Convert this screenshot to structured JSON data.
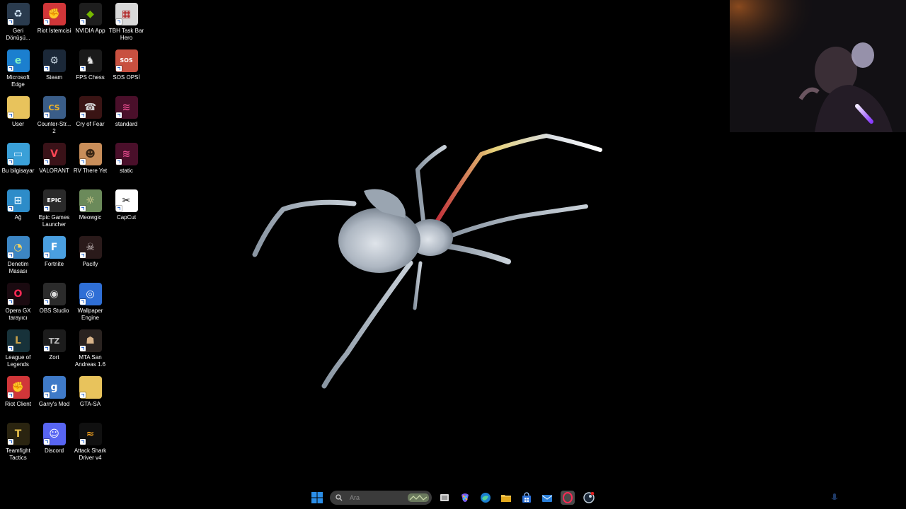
{
  "desktop": {
    "icons": [
      {
        "label": "Geri Dönüşü...",
        "icon": "recycle-bin-icon",
        "bg": "#2a3b4e",
        "glyph": "♻",
        "fg": "#cfe3f4"
      },
      {
        "label": "Microsoft Edge",
        "icon": "edge-icon",
        "bg": "#1b7fcf",
        "glyph": "e",
        "fg": "#7ff0c4"
      },
      {
        "label": "User",
        "icon": "folder-icon",
        "bg": "#e8c35c",
        "glyph": "",
        "fg": "#ffffff"
      },
      {
        "label": "Bu bilgisayar",
        "icon": "this-pc-icon",
        "bg": "#3aa0d8",
        "glyph": "▭",
        "fg": "#d9f1ff"
      },
      {
        "label": "Ağ",
        "icon": "network-icon",
        "bg": "#2d8cc9",
        "glyph": "⊞",
        "fg": "#d9f1ff"
      },
      {
        "label": "Denetim Masası",
        "icon": "control-panel-icon",
        "bg": "#3c86c4",
        "glyph": "◔",
        "fg": "#f5d35f"
      },
      {
        "label": "Opera GX tarayıcı",
        "icon": "opera-gx-icon",
        "bg": "#1a0a10",
        "glyph": "O",
        "fg": "#ff2a55"
      },
      {
        "label": "League of Legends",
        "icon": "league-of-legends-icon",
        "bg": "#17323a",
        "glyph": "L",
        "fg": "#c9a24a"
      },
      {
        "label": "Riot Client",
        "icon": "riot-client-icon",
        "bg": "#d13639",
        "glyph": "✊",
        "fg": "#ffffff"
      },
      {
        "label": "Teamfight Tactics",
        "icon": "teamfight-tactics-icon",
        "bg": "#2a2410",
        "glyph": "T",
        "fg": "#e8c04a"
      },
      {
        "label": "Riot İstemcisi",
        "icon": "riot-client-icon",
        "bg": "#d13639",
        "glyph": "✊",
        "fg": "#ffffff"
      },
      {
        "label": "Steam",
        "icon": "steam-icon",
        "bg": "#1b2838",
        "glyph": "⚙",
        "fg": "#c7d5e0"
      },
      {
        "label": "Counter-Str... 2",
        "icon": "counter-strike-icon",
        "bg": "#3a5d88",
        "glyph": "CS",
        "fg": "#f0b429"
      },
      {
        "label": "VALORANT",
        "icon": "valorant-icon",
        "bg": "#3a1218",
        "glyph": "V",
        "fg": "#ff4655"
      },
      {
        "label": "Epic Games Launcher",
        "icon": "epic-games-icon",
        "bg": "#2a2a2a",
        "glyph": "EPIC",
        "fg": "#ffffff"
      },
      {
        "label": "Fortnite",
        "icon": "fortnite-icon",
        "bg": "#4a9fe0",
        "glyph": "F",
        "fg": "#ffffff"
      },
      {
        "label": "OBS Studio",
        "icon": "obs-studio-icon",
        "bg": "#2b2b2b",
        "glyph": "◉",
        "fg": "#dcdcdc"
      },
      {
        "label": "Zort",
        "icon": "zort-icon",
        "bg": "#1c1c1c",
        "glyph": "TZ",
        "fg": "#bdbdbd"
      },
      {
        "label": "Garry's Mod",
        "icon": "garrys-mod-icon",
        "bg": "#3f7ac8",
        "glyph": "g",
        "fg": "#ffffff"
      },
      {
        "label": "Discord",
        "icon": "discord-icon",
        "bg": "#5865f2",
        "glyph": "☺",
        "fg": "#ffffff"
      },
      {
        "label": "NVIDIA App",
        "icon": "nvidia-icon",
        "bg": "#1e1e1e",
        "glyph": "◆",
        "fg": "#76b900"
      },
      {
        "label": "FPS Chess",
        "icon": "fps-chess-icon",
        "bg": "#1a1a1a",
        "glyph": "♞",
        "fg": "#e6e6e6"
      },
      {
        "label": "Cry of Fear",
        "icon": "cry-of-fear-icon",
        "bg": "#3a1414",
        "glyph": "☎",
        "fg": "#cfcfcf"
      },
      {
        "label": "RV There Yet",
        "icon": "rv-there-yet-icon",
        "bg": "#c98e5a",
        "glyph": "☻",
        "fg": "#3a2614"
      },
      {
        "label": "Meowgic",
        "icon": "meowgic-icon",
        "bg": "#6b8a5a",
        "glyph": "☼",
        "fg": "#f4e3a2"
      },
      {
        "label": "Pacify",
        "icon": "pacify-icon",
        "bg": "#2a1a1a",
        "glyph": "☠",
        "fg": "#d0c6c6"
      },
      {
        "label": "Wallpaper Engine",
        "icon": "wallpaper-engine-icon",
        "bg": "#2f6fd6",
        "glyph": "◎",
        "fg": "#ffffff"
      },
      {
        "label": "MTA San Andreas 1.6",
        "icon": "mta-san-andreas-icon",
        "bg": "#2a2320",
        "glyph": "☗",
        "fg": "#d9b48a"
      },
      {
        "label": "GTA-SA",
        "icon": "folder-icon",
        "bg": "#e8c35c",
        "glyph": "",
        "fg": "#ffffff"
      },
      {
        "label": "Attack Shark Driver v4",
        "icon": "attack-shark-icon",
        "bg": "#101010",
        "glyph": "≈",
        "fg": "#f0a020"
      },
      {
        "label": "TBH Task Bar Hero",
        "icon": "tbh-task-bar-hero-icon",
        "bg": "#d8d8d8",
        "glyph": "▦",
        "fg": "#b02020"
      },
      {
        "label": "SOS OPSİ",
        "icon": "sos-opsi-icon",
        "bg": "#c85040",
        "glyph": "SOS",
        "fg": "#ffffff"
      },
      {
        "label": "standard",
        "icon": "app-icon",
        "bg": "#4a0f2a",
        "glyph": "≋",
        "fg": "#e04a8a"
      },
      {
        "label": "static",
        "icon": "app-icon",
        "bg": "#4a0f2a",
        "glyph": "≋",
        "fg": "#e04a8a"
      },
      {
        "label": "CapCut",
        "icon": "capcut-icon",
        "bg": "#ffffff",
        "glyph": "✂",
        "fg": "#000000"
      }
    ]
  },
  "taskbar": {
    "search_placeholder": "Ara",
    "items": [
      {
        "icon": "start-icon",
        "name": "start-button"
      },
      {
        "icon": "task-view-icon",
        "name": "task-view-button"
      },
      {
        "icon": "copilot-icon",
        "name": "copilot-button"
      },
      {
        "icon": "edge-icon",
        "name": "edge-taskbar-button"
      },
      {
        "icon": "file-explorer-icon",
        "name": "file-explorer-button"
      },
      {
        "icon": "microsoft-store-icon",
        "name": "store-button"
      },
      {
        "icon": "mail-icon",
        "name": "mail-button"
      },
      {
        "icon": "opera-gx-icon",
        "name": "opera-gx-taskbar-button"
      },
      {
        "icon": "steam-icon",
        "name": "steam-taskbar-button"
      }
    ],
    "tray_icon": "microphone-icon",
    "weather_icon": "weather-icon"
  },
  "overlay": {
    "webcam": "webcam-feed"
  }
}
